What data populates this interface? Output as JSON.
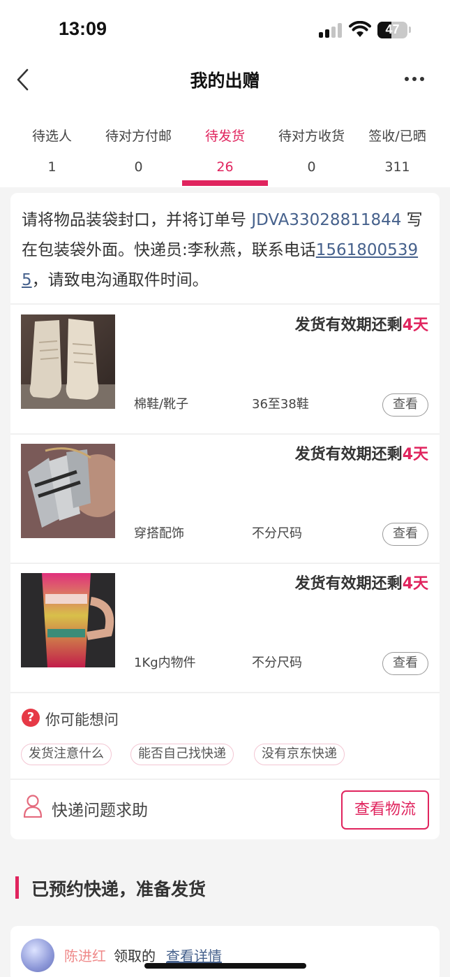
{
  "status_bar": {
    "time": "13:09",
    "battery": "47",
    "battery_level": 0.47
  },
  "nav": {
    "title": "我的出赠"
  },
  "tabs": [
    {
      "label": "待选人",
      "count": "1",
      "active": false
    },
    {
      "label": "待对方付邮",
      "count": "0",
      "active": false
    },
    {
      "label": "待发货",
      "count": "26",
      "active": true
    },
    {
      "label": "待对方收货",
      "count": "0",
      "active": false
    },
    {
      "label": "签收/已晒",
      "count": "311",
      "active": false
    }
  ],
  "notice": {
    "prefix": "请将物品装袋封口，并将订单号 ",
    "order_no": "JDVA33028811844",
    "middle": " 写在包装袋外面。快递员:李秋燕，联系电话",
    "phone": "15618005395",
    "suffix": "，请致电沟通取件时间。"
  },
  "deadline": {
    "text": "发货有效期还剩",
    "days": "4天"
  },
  "view_label": "查看",
  "items": [
    {
      "category": "棉鞋/靴子",
      "size": "36至38鞋"
    },
    {
      "category": "穿搭配饰",
      "size": "不分尺码"
    },
    {
      "category": "1Kg内物件",
      "size": "不分尺码"
    }
  ],
  "faq": {
    "title": "你可能想问",
    "chips": [
      "发货注意什么",
      "能否自己找快递",
      "没有京东快递"
    ]
  },
  "help": {
    "label": "快递问题求助",
    "button": "查看物流"
  },
  "section": {
    "title": "已预约快递，准备发货"
  },
  "claim": {
    "name": "陈进红",
    "text": "领取的",
    "link": "查看详情"
  },
  "colors": {
    "accent": "#e0245e",
    "link": "#46618c",
    "background": "#f4f4f4"
  },
  "icons": [
    "back-arrow-icon",
    "more-icon",
    "question-icon",
    "person-icon",
    "wifi-icon",
    "signal-icon",
    "battery-icon"
  ]
}
